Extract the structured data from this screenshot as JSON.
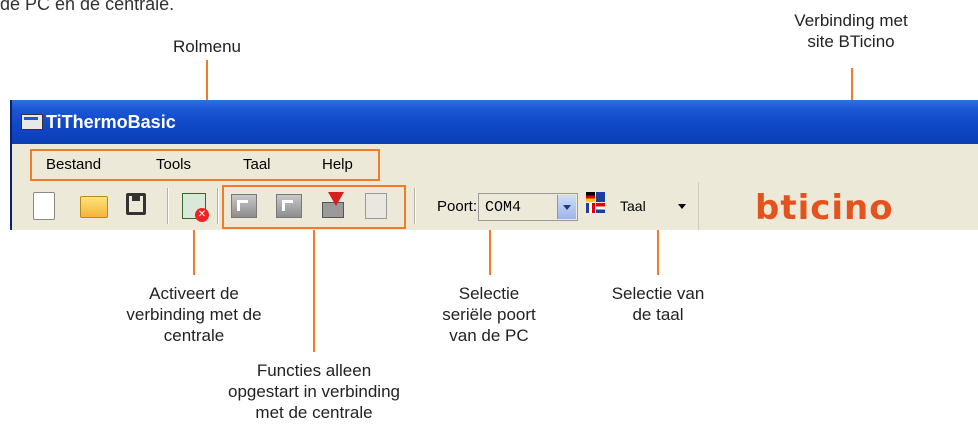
{
  "page": {
    "top_text": "de PC en de centrale."
  },
  "window": {
    "title": "TiThermoBasic"
  },
  "menu": [
    "Bestand",
    "Tools",
    "Taal",
    "Help"
  ],
  "toolbar": {
    "port_label": "Poort:",
    "port_value": "COM4",
    "language_value": "Taal",
    "brand": "bticino"
  },
  "callouts": {
    "rolmenu": "Rolmenu",
    "verbinding_site": [
      "Verbinding met",
      "site BTicino"
    ],
    "activeert": [
      "Activeert de",
      "verbinding met de",
      "centrale"
    ],
    "functies": [
      "Functies alleen",
      "opgestart in verbinding",
      "met de centrale"
    ],
    "seriele_poort": [
      "Selectie",
      "seriële poort",
      "van de PC"
    ],
    "taal": [
      "Selectie van",
      "de taal"
    ]
  },
  "colors": {
    "callout_orange": "#f07c2a",
    "titlebar_blue": "#0f47c5",
    "brand_orange": "#e4531e"
  },
  "icons": [
    "new-document-icon",
    "open-folder-icon",
    "save-disk-icon",
    "connect-icon",
    "disabled-function-icon",
    "disabled-function-icon",
    "download-icon",
    "disabled-document-icon",
    "language-flags-icon"
  ]
}
